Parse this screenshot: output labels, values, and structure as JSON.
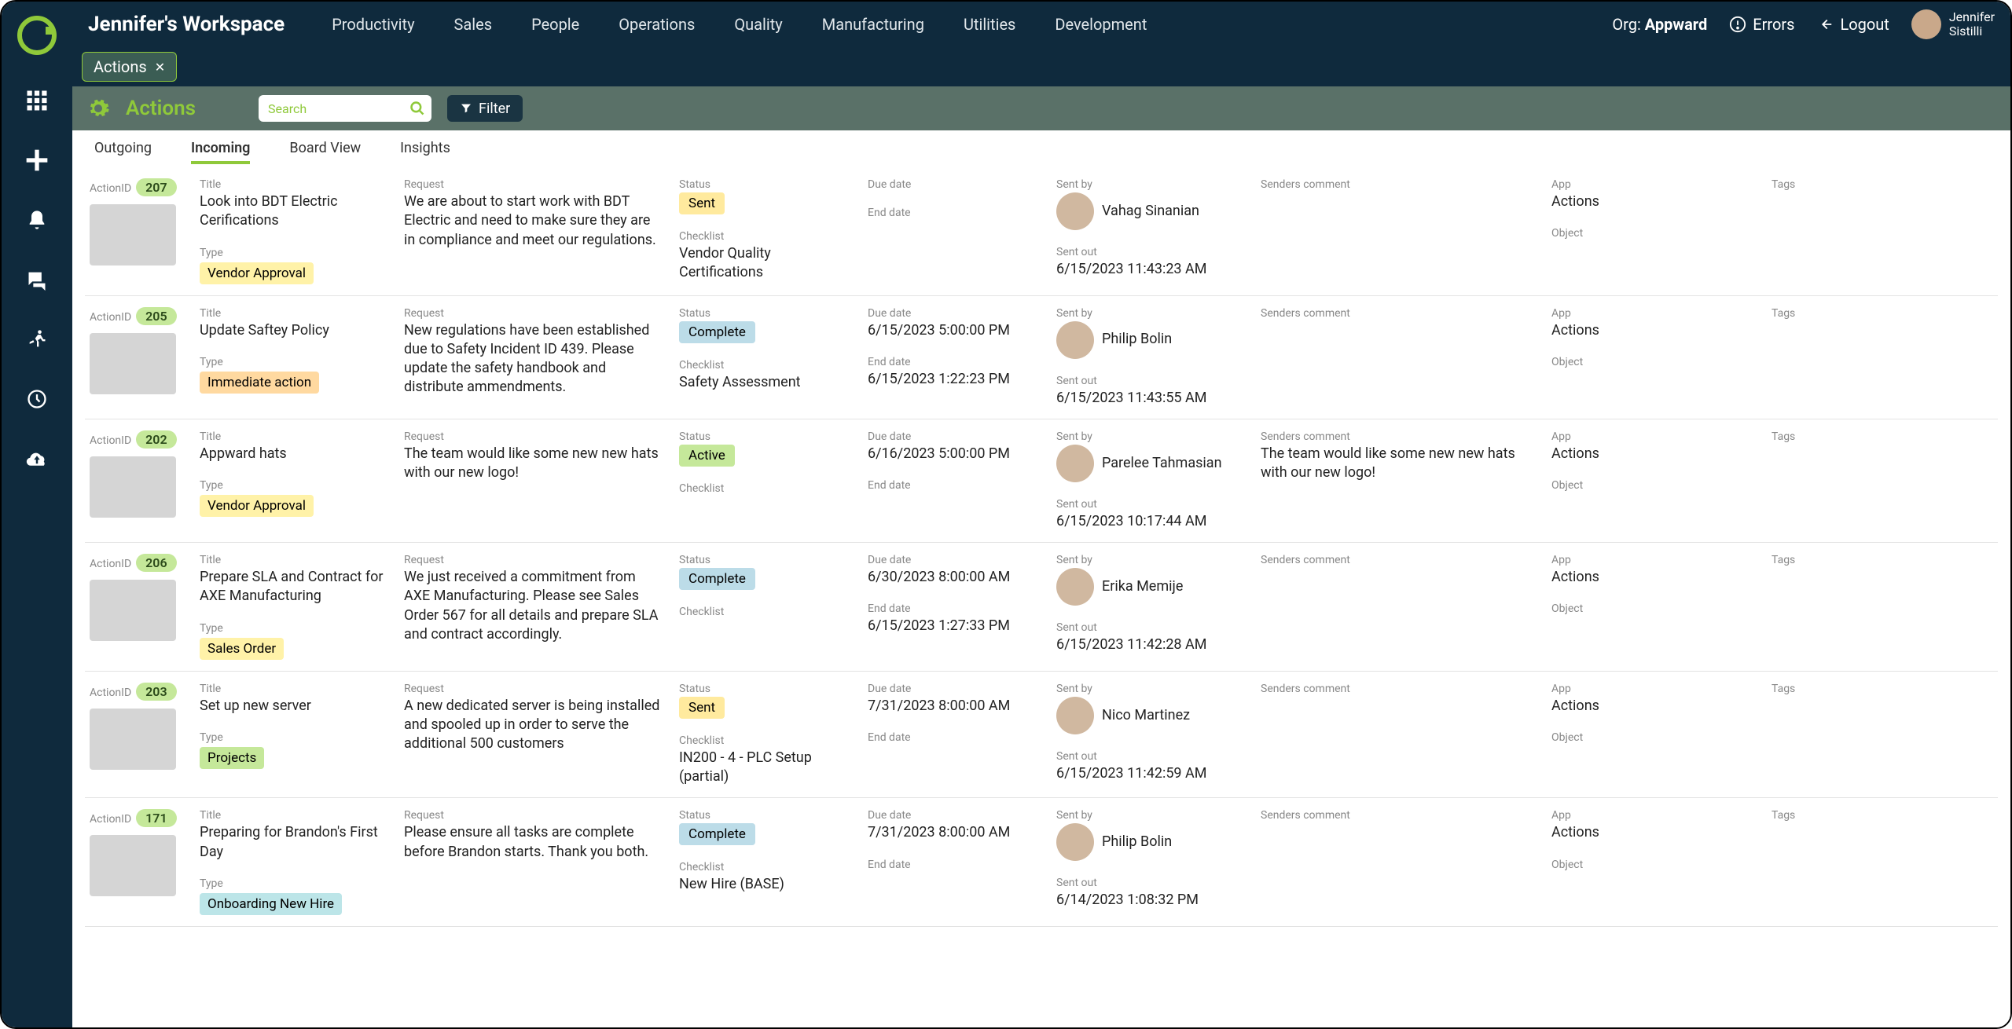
{
  "workspace_title": "Jennifer's Workspace",
  "nav": [
    "Productivity",
    "Sales",
    "People",
    "Operations",
    "Quality",
    "Manufacturing",
    "Utilities",
    "Development"
  ],
  "org_label": "Org:",
  "org_name": "Appward",
  "errors_label": "Errors",
  "logout_label": "Logout",
  "user": {
    "first": "Jennifer",
    "last": "Sistilli"
  },
  "tab_chip": "Actions",
  "page_title": "Actions",
  "search_placeholder": "Search",
  "filter_label": "Filter",
  "sub_tabs": [
    "Outgoing",
    "Incoming",
    "Board View",
    "Insights"
  ],
  "active_sub_tab": 1,
  "labels": {
    "actionid": "ActionID",
    "title": "Title",
    "type": "Type",
    "request": "Request",
    "status": "Status",
    "checklist": "Checklist",
    "due_date": "Due date",
    "end_date": "End date",
    "sent_by": "Sent by",
    "sent_out": "Sent out",
    "senders_comment": "Senders comment",
    "app": "App",
    "object": "Object",
    "tags": "Tags"
  },
  "rows": [
    {
      "id": "207",
      "title": "Look into BDT Electric Cerifications",
      "type": "Vendor Approval",
      "type_class": "type-yellow",
      "request": "We are about to start work with BDT Electric and need to make sure they are in compliance and meet our regulations.",
      "status": "Sent",
      "status_class": "status-sent",
      "checklist": "Vendor Quality Certifications",
      "due_date": "",
      "end_date": "",
      "sent_by": "Vahag Sinanian",
      "sent_out": "6/15/2023 11:43:23 AM",
      "comment": "",
      "app": "Actions",
      "object": ""
    },
    {
      "id": "205",
      "title": "Update Saftey Policy",
      "type": "Immediate action",
      "type_class": "type-orange",
      "request": "New regulations have been established due to Safety Incident ID 439. Please update the safety handbook and distribute ammendments.",
      "status": "Complete",
      "status_class": "status-complete",
      "checklist": "Safety Assessment",
      "due_date": "6/15/2023 5:00:00 PM",
      "end_date": "6/15/2023 1:22:23 PM",
      "sent_by": "Philip Bolin",
      "sent_out": "6/15/2023 11:43:55 AM",
      "comment": "",
      "app": "Actions",
      "object": ""
    },
    {
      "id": "202",
      "title": "Appward hats",
      "type": "Vendor Approval",
      "type_class": "type-yellow",
      "request": "The team would like some new new hats with our new logo!",
      "status": "Active",
      "status_class": "status-active",
      "checklist": "",
      "due_date": "6/16/2023 5:00:00 PM",
      "end_date": "",
      "sent_by": "Parelee Tahmasian",
      "sent_out": "6/15/2023 10:17:44 AM",
      "comment": "The team would like some new new hats with our new logo!",
      "app": "Actions",
      "object": ""
    },
    {
      "id": "206",
      "title": "Prepare SLA and Contract for AXE Manufacturing",
      "type": "Sales Order",
      "type_class": "type-yellow",
      "request": "We just received a commitment from AXE Manufacturing. Please see Sales Order 567 for all details and prepare SLA and contract accordingly.",
      "status": "Complete",
      "status_class": "status-complete",
      "checklist": "",
      "due_date": "6/30/2023 8:00:00 AM",
      "end_date": "6/15/2023 1:27:33 PM",
      "sent_by": "Erika Memije",
      "sent_out": "6/15/2023 11:42:28 AM",
      "comment": "",
      "app": "Actions",
      "object": ""
    },
    {
      "id": "203",
      "title": "Set up new server",
      "type": "Projects",
      "type_class": "type-green",
      "request": "A new dedicated server is being installed and spooled up in order to serve the additional 500 customers",
      "status": "Sent",
      "status_class": "status-sent",
      "checklist": "IN200 - 4 - PLC Setup (partial)",
      "due_date": "7/31/2023 8:00:00 AM",
      "end_date": "",
      "sent_by": "Nico Martinez",
      "sent_out": "6/15/2023 11:42:59 AM",
      "comment": "",
      "app": "Actions",
      "object": ""
    },
    {
      "id": "171",
      "title": "Preparing for Brandon's First Day",
      "type": "Onboarding New Hire",
      "type_class": "type-blue",
      "request": "Please ensure all tasks are complete before Brandon starts. Thank you both.",
      "status": "Complete",
      "status_class": "status-complete",
      "checklist": "New Hire (BASE)",
      "due_date": "7/31/2023 8:00:00 AM",
      "end_date": "",
      "sent_by": "Philip Bolin",
      "sent_out": "6/14/2023 1:08:32 PM",
      "comment": "",
      "app": "Actions",
      "object": ""
    }
  ]
}
